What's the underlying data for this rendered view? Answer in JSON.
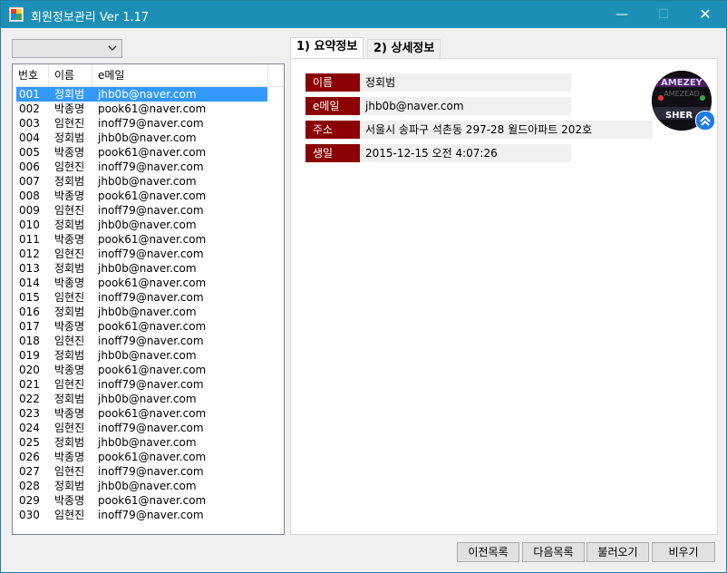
{
  "window": {
    "title": "회원정보관리  Ver 1.17",
    "minimize": "—",
    "maximize": "☐",
    "close": "✕"
  },
  "combo": {
    "value": ""
  },
  "list": {
    "headers": [
      "번호",
      "이름",
      "e메일"
    ],
    "selected_index": 0,
    "rows": [
      [
        "001",
        "정회범",
        "jhb0b@naver.com"
      ],
      [
        "002",
        "박종명",
        "pook61@naver.com"
      ],
      [
        "003",
        "임현진",
        "inoff79@naver.com"
      ],
      [
        "004",
        "정회범",
        "jhb0b@naver.com"
      ],
      [
        "005",
        "박종명",
        "pook61@naver.com"
      ],
      [
        "006",
        "임현진",
        "inoff79@naver.com"
      ],
      [
        "007",
        "정회범",
        "jhb0b@naver.com"
      ],
      [
        "008",
        "박종명",
        "pook61@naver.com"
      ],
      [
        "009",
        "임현진",
        "inoff79@naver.com"
      ],
      [
        "010",
        "정회범",
        "jhb0b@naver.com"
      ],
      [
        "011",
        "박종명",
        "pook61@naver.com"
      ],
      [
        "012",
        "임현진",
        "inoff79@naver.com"
      ],
      [
        "013",
        "정회범",
        "jhb0b@naver.com"
      ],
      [
        "014",
        "박종명",
        "pook61@naver.com"
      ],
      [
        "015",
        "임현진",
        "inoff79@naver.com"
      ],
      [
        "016",
        "정회범",
        "jhb0b@naver.com"
      ],
      [
        "017",
        "박종명",
        "pook61@naver.com"
      ],
      [
        "018",
        "임현진",
        "inoff79@naver.com"
      ],
      [
        "019",
        "정회범",
        "jhb0b@naver.com"
      ],
      [
        "020",
        "박종명",
        "pook61@naver.com"
      ],
      [
        "021",
        "임현진",
        "inoff79@naver.com"
      ],
      [
        "022",
        "정회범",
        "jhb0b@naver.com"
      ],
      [
        "023",
        "박종명",
        "pook61@naver.com"
      ],
      [
        "024",
        "임현진",
        "inoff79@naver.com"
      ],
      [
        "025",
        "정회범",
        "jhb0b@naver.com"
      ],
      [
        "026",
        "박종명",
        "pook61@naver.com"
      ],
      [
        "027",
        "임현진",
        "inoff79@naver.com"
      ],
      [
        "028",
        "정회범",
        "jhb0b@naver.com"
      ],
      [
        "029",
        "박종명",
        "pook61@naver.com"
      ],
      [
        "030",
        "임현진",
        "inoff79@naver.com"
      ]
    ]
  },
  "tabs": [
    {
      "label": "1) 요약정보",
      "active": true
    },
    {
      "label": "2) 상세정보",
      "active": false
    }
  ],
  "summary": {
    "name_label": "이름",
    "name_value": "정회범",
    "email_label": "e메일",
    "email_value": "jhb0b@naver.com",
    "address_label": "주소",
    "address_value": "서울시 송파구 석촌동 297-28 윌드아파트 202호",
    "birth_label": "생일",
    "birth_value": "2015-12-15 오전 4:07:26"
  },
  "avatar": {
    "icon": "profile-photo",
    "badge_icon": "chevron-up-icon",
    "badge_color": "#1e7be6"
  },
  "buttons": {
    "prev": "이전목록",
    "next": "다음목록",
    "load": "불러오기",
    "clear": "비우기"
  },
  "colors": {
    "titlebar": "#1b8fb5",
    "label_bg": "#8b0000",
    "selection": "#3399ff"
  }
}
